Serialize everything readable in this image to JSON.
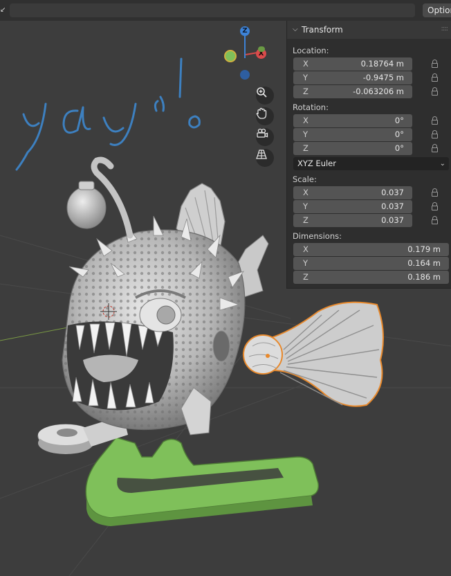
{
  "header": {
    "options_label": "Option",
    "corner_icon": "chevron-icon"
  },
  "viewport": {
    "handwriting": "yay!",
    "gizmo": {
      "z_label": "Z",
      "x_label": "X"
    },
    "tools": [
      "zoom-icon",
      "hand-pan-icon",
      "camera-view-icon",
      "grid-perspective-icon"
    ],
    "colors": {
      "background": "#3d3d3d",
      "green_part": "#7fc05a",
      "selection_outline": "#e8892c",
      "handwriting": "#3d80c0"
    }
  },
  "panel": {
    "title": "Transform",
    "location": {
      "label": "Location:",
      "fields": [
        {
          "axis": "X",
          "value": "0.18764 m"
        },
        {
          "axis": "Y",
          "value": "-0.9475 m"
        },
        {
          "axis": "Z",
          "value": "-0.063206 m"
        }
      ]
    },
    "rotation": {
      "label": "Rotation:",
      "fields": [
        {
          "axis": "X",
          "value": "0°"
        },
        {
          "axis": "Y",
          "value": "0°"
        },
        {
          "axis": "Z",
          "value": "0°"
        }
      ],
      "mode": "XYZ Euler"
    },
    "scale": {
      "label": "Scale:",
      "fields": [
        {
          "axis": "X",
          "value": "0.037"
        },
        {
          "axis": "Y",
          "value": "0.037"
        },
        {
          "axis": "Z",
          "value": "0.037"
        }
      ]
    },
    "dimensions": {
      "label": "Dimensions:",
      "fields": [
        {
          "axis": "X",
          "value": "0.179 m"
        },
        {
          "axis": "Y",
          "value": "0.164 m"
        },
        {
          "axis": "Z",
          "value": "0.186 m"
        }
      ]
    }
  }
}
